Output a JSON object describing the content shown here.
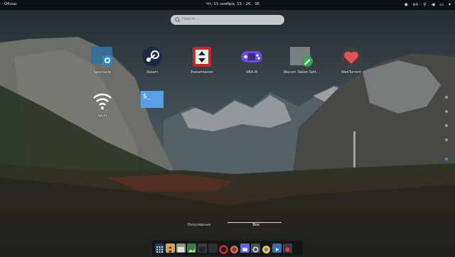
{
  "topbar": {
    "activities": "Обзор",
    "clock": "Чт, 15 ноября, 15 : 26 : 36",
    "lang": "en"
  },
  "search": {
    "placeholder": "Найти..."
  },
  "apps": [
    {
      "label": "Spectacle",
      "icon": "camera-icon",
      "color": "#2e87c8"
    },
    {
      "label": "Steam",
      "icon": "steam-icon",
      "color": "#1a2b45"
    },
    {
      "label": "Transmission",
      "icon": "transmission-icon",
      "color": "#c62828"
    },
    {
      "label": "VBA-M",
      "icon": "gamepad-icon",
      "color": "#6a4bd6"
    },
    {
      "label": "Wacom Tablet Sett...",
      "icon": "wacom-icon",
      "color": "#3aa356"
    },
    {
      "label": "WebTorrent",
      "icon": "heart-icon",
      "color": "#e85057"
    },
    {
      "label": "Wi-Fi",
      "icon": "wifi-icon",
      "color": "#ffffff"
    },
    {
      "label": "",
      "icon": "terminal-icon",
      "color": "#4a8fe0"
    }
  ],
  "tabs": {
    "frequent": "Популярные",
    "all": "Все"
  },
  "colors": {
    "accent": "#3d8fe0",
    "topbar": "#0d0f10"
  }
}
